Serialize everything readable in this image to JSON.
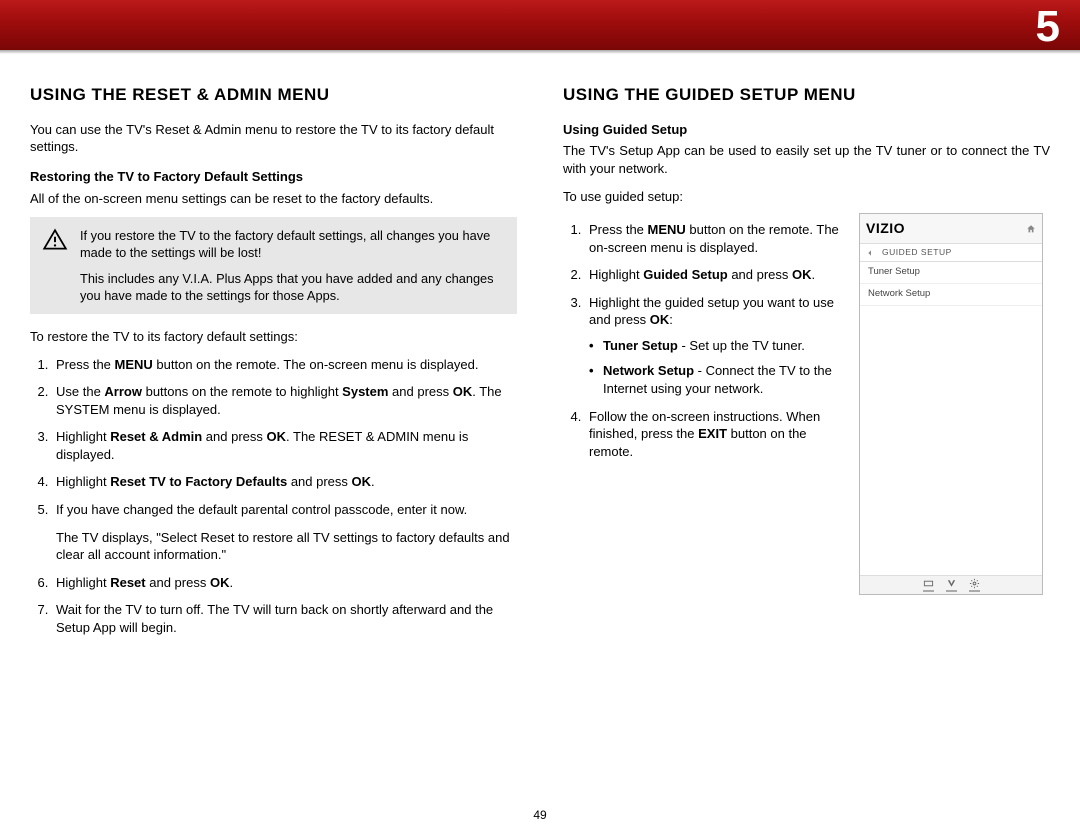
{
  "header": {
    "chapter_number": "5"
  },
  "left": {
    "heading": "USING THE RESET & ADMIN MENU",
    "intro": "You can use the TV's Reset & Admin menu to restore the TV to its factory default settings.",
    "subhead": "Restoring the TV to Factory Default Settings",
    "subintro": "All of the on-screen menu settings can be reset to the factory defaults.",
    "warning": {
      "line1": "If you restore the TV to the factory default settings, all changes you have made to the settings will be lost!",
      "line2": "This includes any V.I.A. Plus Apps that you have added and any changes you have made to the settings for those Apps."
    },
    "lead": "To restore the TV to its factory default settings:",
    "steps": {
      "s1a": "Press the ",
      "s1b": "MENU",
      "s1c": " button on the remote. The on-screen menu is displayed.",
      "s2a": "Use the ",
      "s2b": "Arrow",
      "s2c": " buttons on the remote to highlight ",
      "s2d": "System",
      "s2e": " and press ",
      "s2f": "OK",
      "s2g": ". The SYSTEM menu is displayed.",
      "s3a": "Highlight ",
      "s3b": "Reset & Admin",
      "s3c": " and press ",
      "s3d": "OK",
      "s3e": ". The RESET & ADMIN menu is displayed.",
      "s4a": "Highlight ",
      "s4b": "Reset TV to Factory Defaults",
      "s4c": " and press ",
      "s4d": "OK",
      "s4e": ".",
      "s5": "If you have changed the default parental control passcode, enter it now.",
      "s5_note": "The TV displays, \"Select Reset to restore all TV settings to factory defaults and clear all account information.\"",
      "s6a": "Highlight ",
      "s6b": "Reset",
      "s6c": " and press ",
      "s6d": "OK",
      "s6e": ".",
      "s7": "Wait for the TV to turn off. The TV will turn back on shortly afterward and the Setup App will begin."
    }
  },
  "right": {
    "heading": "USING THE GUIDED SETUP MENU",
    "subhead": "Using Guided Setup",
    "intro": "The TV's Setup App can be used to easily set up the TV tuner or to connect the TV with your network.",
    "lead": "To use guided setup:",
    "steps": {
      "s1a": "Press the ",
      "s1b": "MENU",
      "s1c": " button on the remote. The on-screen menu is displayed.",
      "s2a": "Highlight ",
      "s2b": "Guided Setup",
      "s2c": " and press ",
      "s2d": "OK",
      "s2e": ".",
      "s3a": "Highlight the guided setup you want to use and press ",
      "s3b": "OK",
      "s3c": ":",
      "b1a": "Tuner Setup",
      "b1b": " - Set up the TV tuner.",
      "b2a": "Network Setup",
      "b2b": " - Connect the TV to the Internet using your network.",
      "s4a": "Follow the on-screen instructions. When finished, press the ",
      "s4b": "EXIT",
      "s4c": " button on the remote."
    }
  },
  "panel": {
    "logo": "VIZIO",
    "breadcrumb": "GUIDED SETUP",
    "item1": "Tuner Setup",
    "item2": "Network Setup"
  },
  "page_number": "49"
}
